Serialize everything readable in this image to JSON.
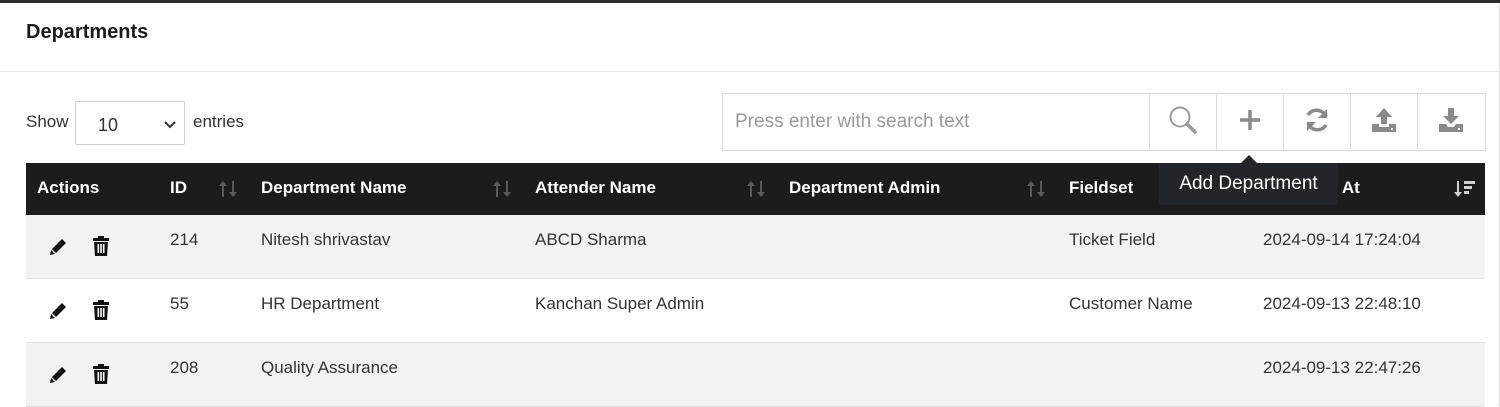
{
  "page": {
    "title": "Departments"
  },
  "length_control": {
    "show_label": "Show",
    "selected": "10",
    "entries_label": "entries"
  },
  "search": {
    "placeholder": "Press enter with search text",
    "value": ""
  },
  "toolbar": {
    "buttons": [
      "search-icon",
      "plus-icon",
      "refresh-icon",
      "upload-icon",
      "download-icon"
    ]
  },
  "tooltip": {
    "text": "Add Department"
  },
  "table": {
    "columns": [
      "Actions",
      "ID",
      "Department Name",
      "Attender Name",
      "Department Admin",
      "Fieldset",
      "l At"
    ],
    "rows": [
      {
        "id": "214",
        "department_name": "Nitesh shrivastav",
        "attender_name": "ABCD Sharma",
        "department_admin": "",
        "fieldset": "Ticket Field",
        "created_at": "2024-09-14 17:24:04"
      },
      {
        "id": "55",
        "department_name": "HR Department",
        "attender_name": "Kanchan Super Admin",
        "department_admin": "",
        "fieldset": "Customer Name",
        "created_at": "2024-09-13 22:48:10"
      },
      {
        "id": "208",
        "department_name": "Quality Assurance",
        "attender_name": "",
        "department_admin": "",
        "fieldset": "",
        "created_at": "2024-09-13 22:47:26"
      }
    ]
  },
  "colors": {
    "header_bg": "#1c1c1c",
    "stripe": "#f2f2f2",
    "tooltip_bg": "#22262b",
    "icon_gray": "#8a8a8a"
  }
}
